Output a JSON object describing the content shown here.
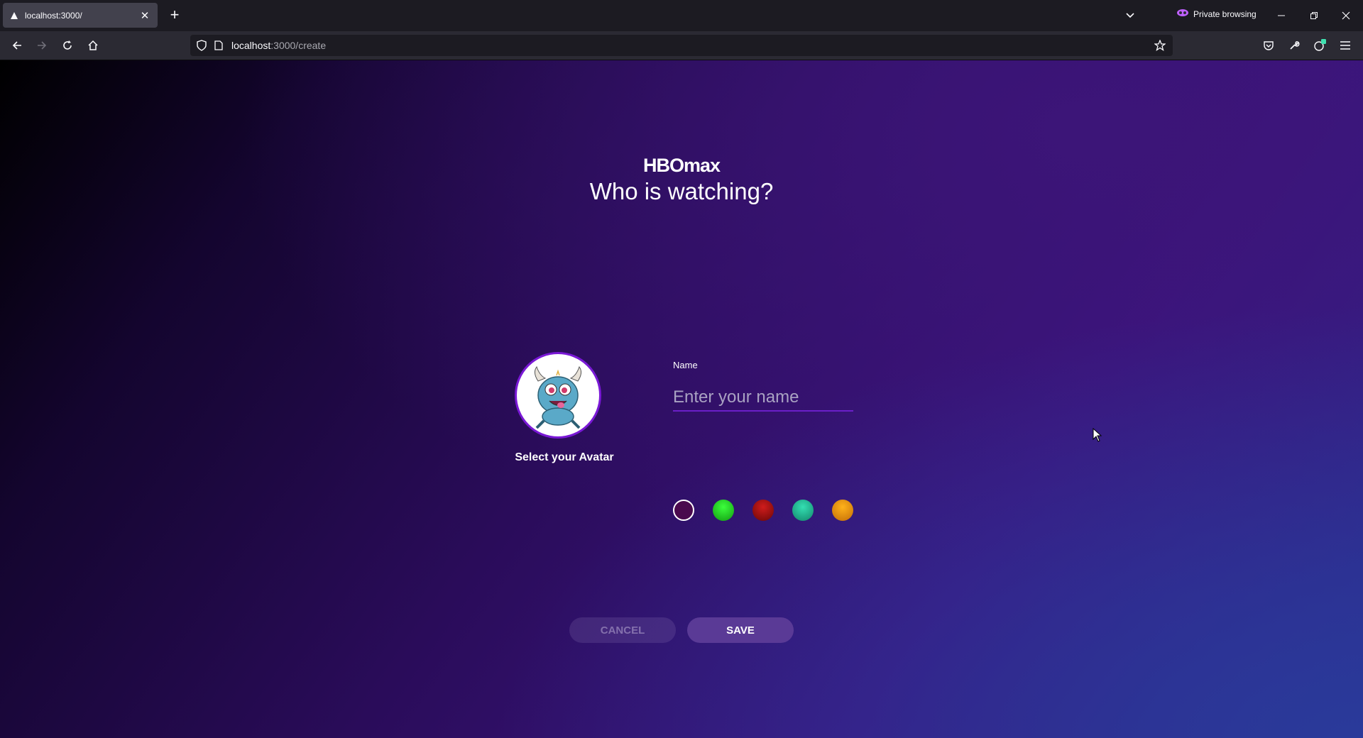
{
  "browser": {
    "tab_title": "localhost:3000/",
    "url_host": "localhost",
    "url_path": ":3000/create",
    "private_label": "Private browsing"
  },
  "page": {
    "logo": "HBOmax",
    "title": "Who is watching?",
    "avatar_caption": "Select your Avatar",
    "name_label": "Name",
    "name_placeholder": "Enter your name",
    "name_value": "",
    "colors": [
      {
        "name": "purple",
        "hex": "#4a0a4e",
        "selected": true
      },
      {
        "name": "green",
        "hex": "#22b422"
      },
      {
        "name": "red",
        "hex": "#a50e0e"
      },
      {
        "name": "teal",
        "hex": "#1fae8e"
      },
      {
        "name": "orange",
        "hex": "#e0900e"
      }
    ],
    "cancel_label": "CANCEL",
    "save_label": "SAVE"
  }
}
